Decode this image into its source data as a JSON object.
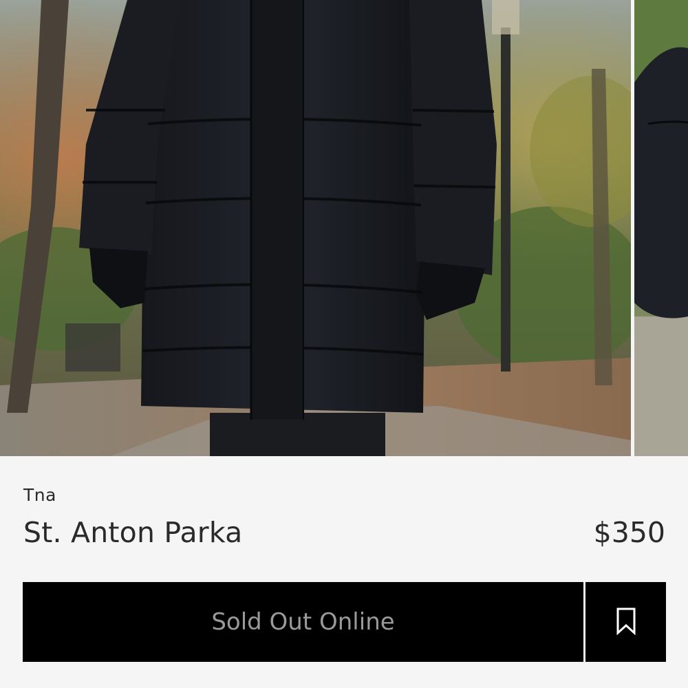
{
  "carousel": {
    "slides": [
      {
        "subject": "model wearing black quilted parka on autumn path"
      },
      {
        "subject": "partial view of next product photo"
      }
    ]
  },
  "product": {
    "brand": "Tna",
    "name": "St. Anton Parka",
    "price": "$350"
  },
  "actions": {
    "primary_label": "Sold Out Online",
    "primary_enabled": false,
    "wishlist_icon": "bookmark-icon"
  },
  "colors": {
    "background": "#f5f5f5",
    "button": "#000000",
    "button_text_disabled": "#9a9a9a",
    "text": "#2a2a2a"
  }
}
